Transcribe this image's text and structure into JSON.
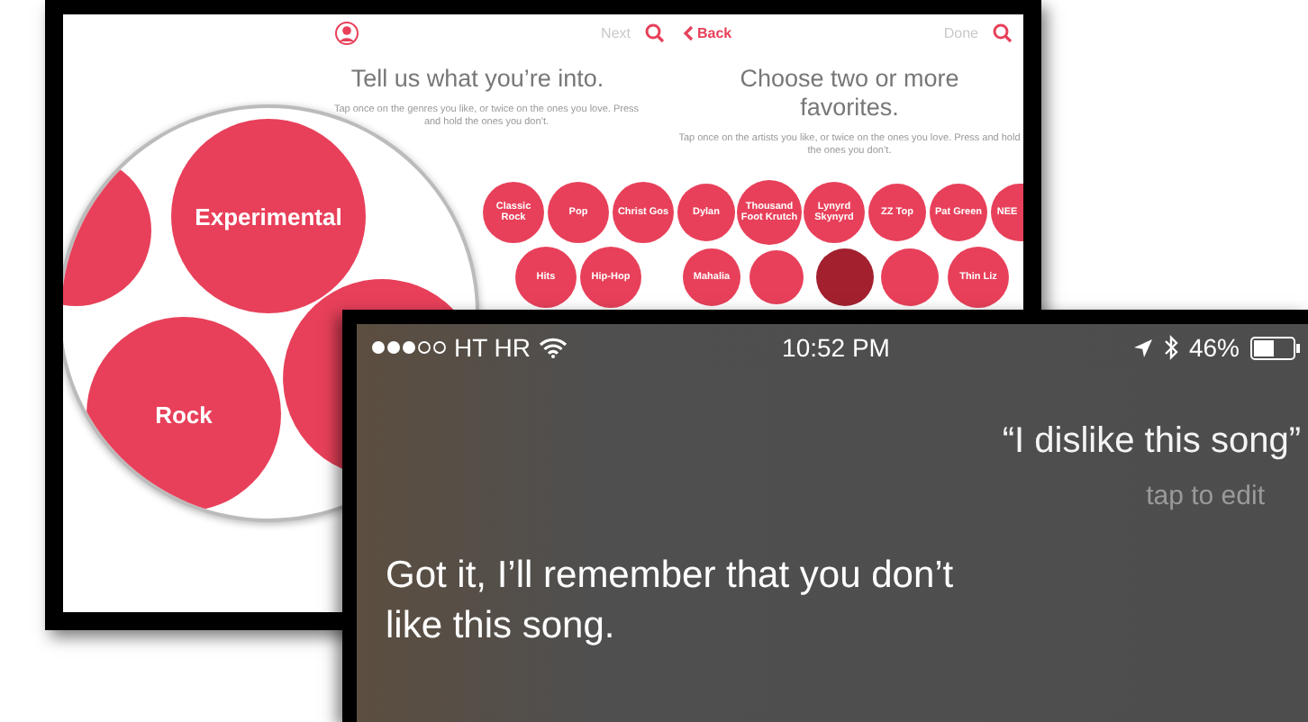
{
  "genre_screen": {
    "next": "Next",
    "title": "Tell us what you’re into.",
    "hint": "Tap once on the genres you like, or twice on the ones you love. Press and hold the ones you don’t.",
    "magnified_bubbles": [
      {
        "label": "Experimental"
      },
      {
        "label": "Rock"
      }
    ],
    "bubbles": [
      {
        "label": "Classic Rock"
      },
      {
        "label": "Pop"
      },
      {
        "label": "Christ Gos"
      },
      {
        "label": "Hits"
      },
      {
        "label": "Hip-Hop"
      }
    ]
  },
  "artist_screen": {
    "back": "Back",
    "done": "Done",
    "title": "Choose two or more favorites.",
    "hint": "Tap once on the artists you like, or twice on the ones you love. Press and hold the ones you don’t.",
    "bubbles": [
      {
        "label": "Dylan"
      },
      {
        "label": "Thousand Foot Krutch"
      },
      {
        "label": "Lynyrd Skynyrd"
      },
      {
        "label": "ZZ Top"
      },
      {
        "label": "Pat Green"
      },
      {
        "label": "NEE"
      },
      {
        "label": "Mahalia"
      },
      {
        "label": "Thin Liz"
      }
    ]
  },
  "siri_screen": {
    "status_bar": {
      "carrier": "HT HR",
      "time": "10:52 PM",
      "battery": "46%"
    },
    "query": "“I dislike this song”",
    "edit_hint": "tap to edit",
    "response": "Got it, I’ll remember that you don’t like this song."
  }
}
